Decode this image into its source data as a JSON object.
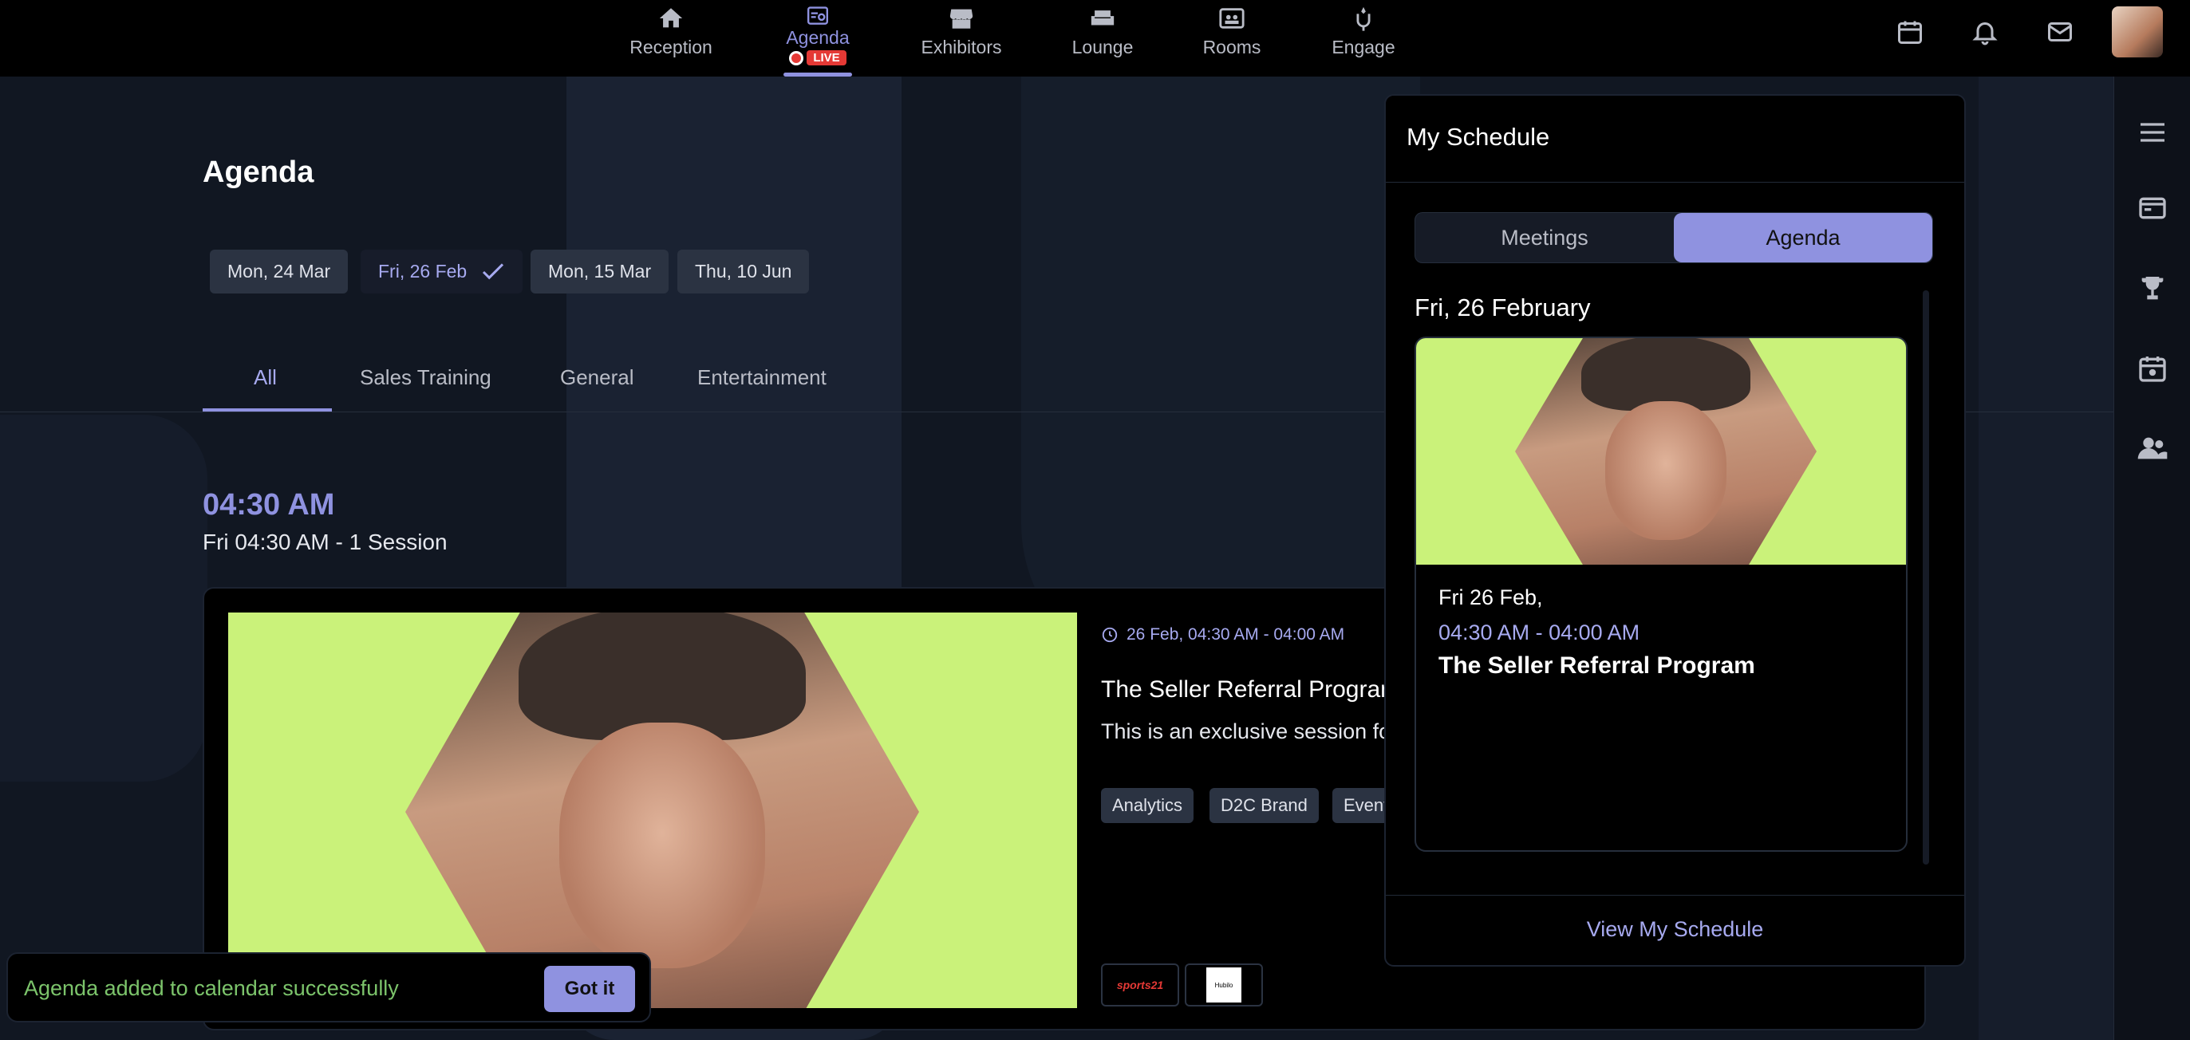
{
  "nav": {
    "items": [
      {
        "label": "Reception",
        "icon": "home-icon"
      },
      {
        "label": "Agenda",
        "icon": "agenda-icon",
        "live": "LIVE"
      },
      {
        "label": "Exhibitors",
        "icon": "store-icon"
      },
      {
        "label": "Lounge",
        "icon": "lounge-icon"
      },
      {
        "label": "Rooms",
        "icon": "rooms-icon"
      },
      {
        "label": "Engage",
        "icon": "engage-icon"
      }
    ]
  },
  "page": {
    "title": "Agenda",
    "dates": [
      "Mon, 24 Mar",
      "Fri, 26 Feb",
      "Mon, 15 Mar",
      "Thu, 10 Jun"
    ],
    "tabs": [
      "All",
      "Sales Training",
      "General",
      "Entertainment"
    ],
    "time_heading": "04:30 AM",
    "time_sub": "Fri 04:30 AM - 1  Session"
  },
  "session": {
    "datetime": "26 Feb, 04:30 AM - 04:00 AM",
    "title": "The Seller Referral Program",
    "description": "This is an exclusive session for Seller Referral Program.",
    "tags": [
      "Analytics",
      "D2C Brand",
      "Event"
    ],
    "sponsors": [
      "sports21",
      "Hubilo"
    ]
  },
  "toast": {
    "message": "Agenda added to calendar successfully",
    "button": "Got it"
  },
  "schedule_panel": {
    "title": "My Schedule",
    "tabs": [
      "Meetings",
      "Agenda"
    ],
    "active_tab": "Agenda",
    "date": "Fri, 26 February",
    "card": {
      "date": "Fri 26 Feb,",
      "time": "04:30 AM - 04:00 AM",
      "title": "The Seller Referral Program"
    },
    "link": "View My Schedule"
  },
  "colors": {
    "accent": "#8f92e0",
    "live": "#e53935",
    "image_bg": "#caf27a",
    "toast_text": "#7cc46b"
  }
}
